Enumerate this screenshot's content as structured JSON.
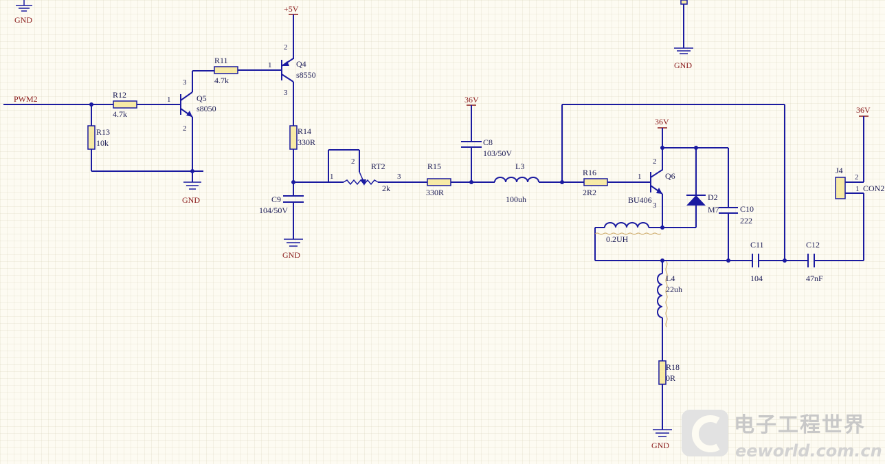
{
  "net_labels": {
    "pwm": "PWM2",
    "gnd": "GND",
    "v5": "+5V",
    "v36": "36V"
  },
  "components": {
    "R11": {
      "ref": "R11",
      "value": "4.7k"
    },
    "R12": {
      "ref": "R12",
      "value": "4.7k"
    },
    "R13": {
      "ref": "R13",
      "value": "10k"
    },
    "R14": {
      "ref": "R14",
      "value": "330R"
    },
    "R15": {
      "ref": "R15",
      "value": "330R"
    },
    "R16": {
      "ref": "R16",
      "value": "2R2"
    },
    "R18": {
      "ref": "R18",
      "value": "0R"
    },
    "RT2": {
      "ref": "RT2",
      "value": "2k"
    },
    "Q4": {
      "ref": "Q4",
      "value": "s8550"
    },
    "Q5": {
      "ref": "Q5",
      "value": "s8050"
    },
    "Q6": {
      "ref": "Q6",
      "value": "BU406"
    },
    "C8": {
      "ref": "C8",
      "value": "103/50V"
    },
    "C9": {
      "ref": "C9",
      "value": "104/50V"
    },
    "C10": {
      "ref": "C10",
      "value": "222"
    },
    "C11": {
      "ref": "C11",
      "value": "104"
    },
    "C12": {
      "ref": "C12",
      "value": "47nF"
    },
    "L3": {
      "ref": "L3",
      "value": "100uh"
    },
    "L4": {
      "ref": "L4",
      "value": "22uh"
    },
    "L_primary": {
      "value": "0.2UH"
    },
    "D2": {
      "ref": "D2",
      "value": "M7"
    },
    "J4": {
      "ref": "J4",
      "value": "CON2"
    }
  },
  "pins": {
    "p1": "1",
    "p2": "2",
    "p3": "3"
  },
  "watermark": {
    "cn": "电子工程世界",
    "en": "eeworld.com.cn"
  },
  "colors": {
    "wire": "#1a1aa0",
    "power_label": "#8a1a1a",
    "resistor_fill": "#f7eaa6",
    "background": "#fdfbf2"
  }
}
